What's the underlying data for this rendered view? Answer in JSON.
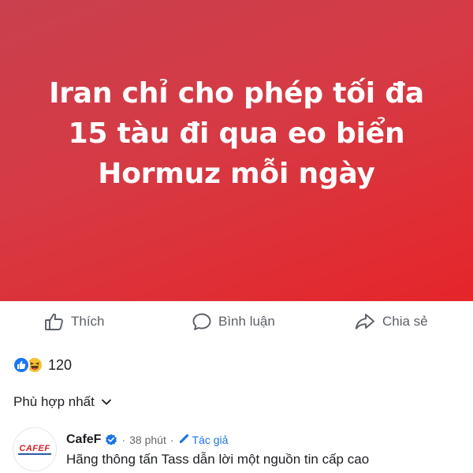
{
  "post": {
    "title": "Iran chỉ cho phép tối đa 15 tàu đi qua eo biển Hormuz mỗi ngày",
    "banner_colors": [
      "#c9404e",
      "#e5252a"
    ]
  },
  "actions": {
    "like_label": "Thích",
    "comment_label": "Bình luận",
    "share_label": "Chia sẻ",
    "icons": [
      "thumbs-up-icon",
      "speech-bubble-icon",
      "share-arrow-icon"
    ]
  },
  "reactions": {
    "types": [
      "like",
      "haha"
    ],
    "count": "120"
  },
  "sort": {
    "label": "Phù hợp nhất",
    "icon": "chevron-down-icon"
  },
  "comment": {
    "avatar_text": "CAFEF",
    "author": "CafeF",
    "verified": true,
    "separator": "·",
    "time": "38 phút",
    "author_badge": "Tác giả",
    "text": "Hãng thông tấn Tass dẫn lời một nguồn tin cấp cao",
    "accent_color": "#1b74e4"
  }
}
